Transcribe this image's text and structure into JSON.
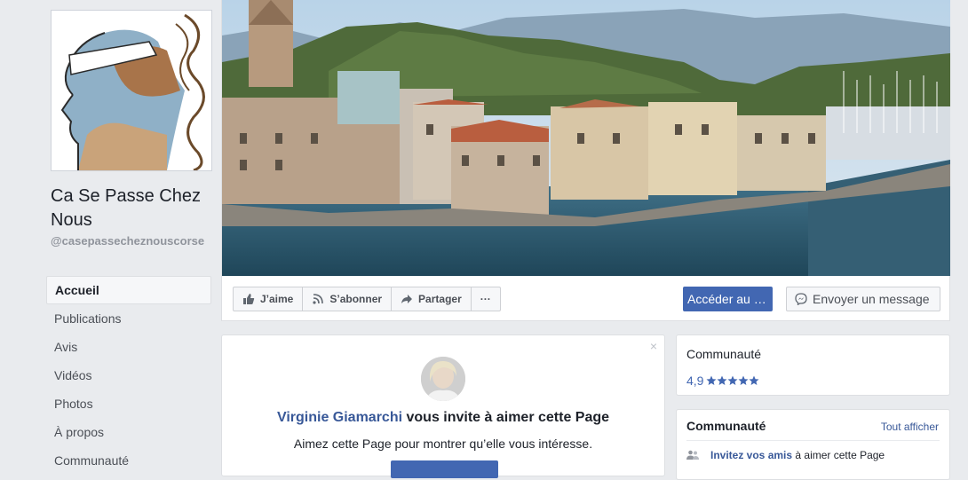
{
  "page": {
    "name": "Ca Se Passe Chez Nous",
    "handle": "@casepassecheznouscorse"
  },
  "nav": {
    "items": [
      {
        "label": "Accueil"
      },
      {
        "label": "Publications"
      },
      {
        "label": "Avis"
      },
      {
        "label": "Vidéos"
      },
      {
        "label": "Photos"
      },
      {
        "label": "À propos"
      },
      {
        "label": "Communauté"
      }
    ]
  },
  "actions": {
    "like": "J’aime",
    "follow": "S’abonner",
    "share": "Partager",
    "more": "···",
    "primary": "Accéder au …",
    "message": "Envoyer un message"
  },
  "invite": {
    "close": "×",
    "inviter": "Virginie Giamarchi",
    "title_rest": " vous invite à aimer cette Page",
    "subtitle": "Aimez cette Page pour montrer qu’elle vous intéresse."
  },
  "community": {
    "title": "Communauté",
    "rating": "4,9",
    "stars": 5
  },
  "community2": {
    "title": "Communauté",
    "see_all": "Tout afficher",
    "invite_link": "Invitez vos amis",
    "invite_rest": " à aimer cette Page"
  },
  "colors": {
    "accent": "#4267b2",
    "link": "#385898",
    "background": "#e9ebee"
  }
}
